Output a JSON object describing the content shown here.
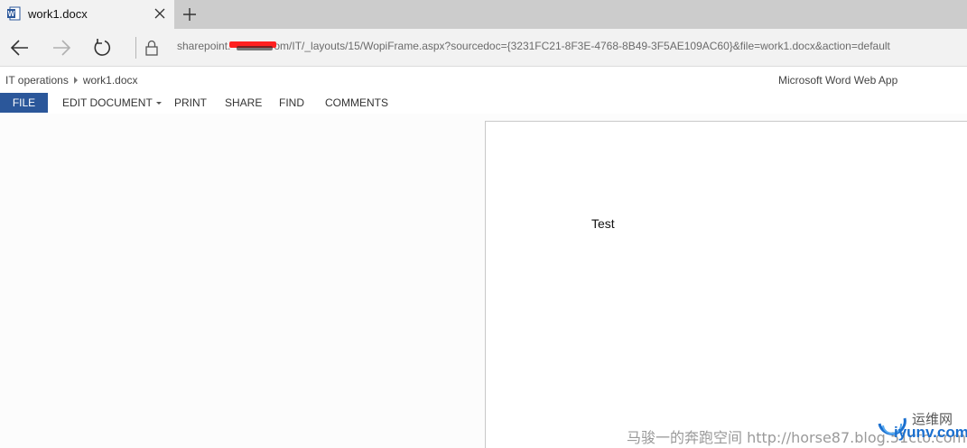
{
  "browser": {
    "tab_title": "work1.docx",
    "url": "sharepoint.    om/IT/_layouts/15/WopiFrame.aspx?sourcedoc={3231FC21-8F3E-4768-8B49-3F5AE109AC60}&file=work1.docx&action=default",
    "icons": {
      "favicon": "word-icon",
      "close": "close-icon",
      "new_tab": "plus-icon",
      "back": "arrow-left-icon",
      "forward": "arrow-right-icon",
      "reload": "reload-icon",
      "lock": "lock-icon"
    }
  },
  "app": {
    "breadcrumb": [
      "IT operations",
      "work1.docx"
    ],
    "name": "Microsoft Word Web App",
    "accent": "#2b579a"
  },
  "ribbon": {
    "file": "FILE",
    "edit": "EDIT DOCUMENT",
    "print": "PRINT",
    "share": "SHARE",
    "find": "FIND",
    "comments": "COMMENTS"
  },
  "document": {
    "body_text": "Test"
  },
  "watermark": {
    "text": "马骏一的奔跑空间 http://horse87.blog.51cto.com",
    "logo_top": "运维网",
    "logo_bottom": "iyunv.com"
  }
}
